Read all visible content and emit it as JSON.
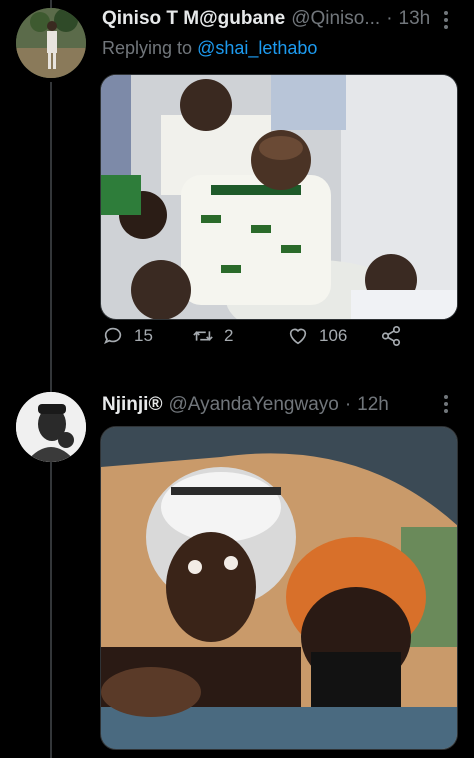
{
  "tweet1": {
    "display_name": "Qiniso T M@gubane",
    "handle": "@Qiniso...",
    "separator": "·",
    "time": "13h",
    "replying_label": "Replying to",
    "replying_handle": "@shai_lethabo",
    "image_desc": "",
    "actions": {
      "reply_count": "15",
      "retweet_count": "2",
      "like_count": "106"
    }
  },
  "tweet2": {
    "display_name": "Njinji®",
    "handle": "@AyandaYengwayo",
    "separator": "·",
    "time": "12h"
  },
  "icons": {
    "more": "more-vertical-icon",
    "reply": "reply-icon",
    "retweet": "retweet-icon",
    "like": "heart-icon",
    "share": "share-icon"
  },
  "colors": {
    "background": "#000000",
    "text": "#e7e9ea",
    "muted": "#71767b",
    "link": "#1d9bf0",
    "divider": "#2f3336"
  }
}
